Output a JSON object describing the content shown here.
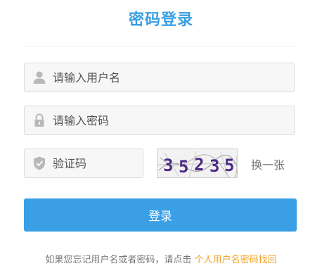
{
  "title": "密码登录",
  "username": {
    "placeholder": "请输入用户名",
    "icon": "user-icon"
  },
  "password": {
    "placeholder": "请输入密码",
    "icon": "lock-icon"
  },
  "captcha": {
    "placeholder": "验证码",
    "icon": "shield-icon",
    "image_text": "35235",
    "refresh_label": "换一张"
  },
  "login_button": "登录",
  "footer": {
    "text": "如果您忘记用户名或者密码，请点击",
    "link": "个人用户名密码找回"
  },
  "colors": {
    "primary": "#3a9fe4",
    "link": "#f0a020",
    "captcha_digits": "#4b2a86"
  }
}
